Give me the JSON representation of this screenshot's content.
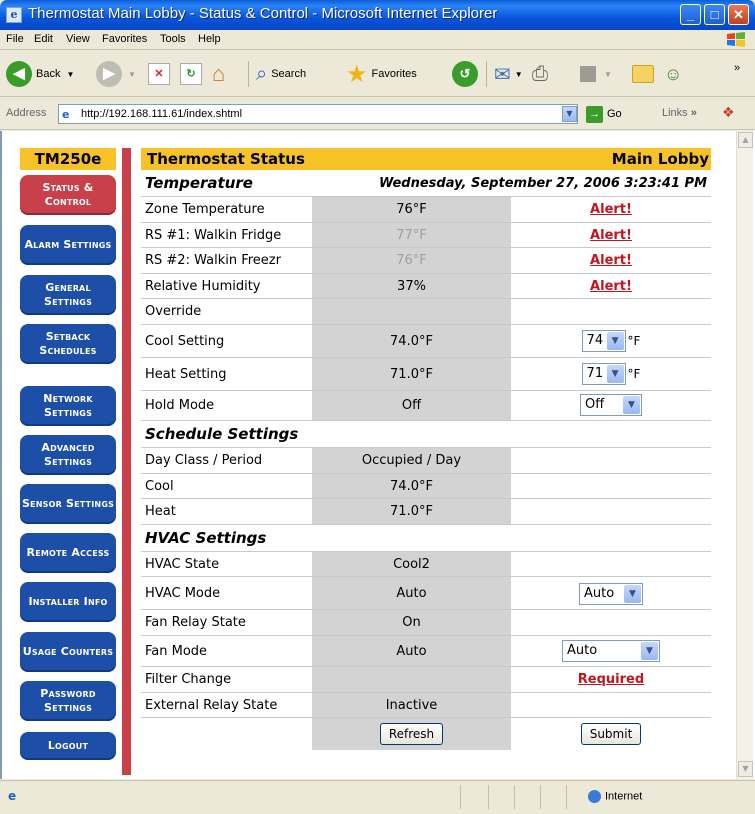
{
  "window": {
    "title": "Thermostat Main Lobby - Status & Control - Microsoft Internet Explorer"
  },
  "menu": [
    "File",
    "Edit",
    "View",
    "Favorites",
    "Tools",
    "Help"
  ],
  "toolbar": {
    "back": "Back",
    "search": "Search",
    "favorites": "Favorites"
  },
  "address": {
    "label": "Address",
    "url": "http://192.168.111.61/index.shtml",
    "go": "Go",
    "links": "Links"
  },
  "sidebar": {
    "brand": "TM250e",
    "items": [
      {
        "label": "Status & Control",
        "active": true
      },
      {
        "label": "Alarm Settings"
      },
      {
        "label": "General Settings"
      },
      {
        "label": "Setback Schedules"
      },
      {
        "label": "Network Settings"
      },
      {
        "label": "Advanced Settings"
      },
      {
        "label": "Sensor Settings"
      },
      {
        "label": "Remote Access"
      },
      {
        "label": "Installer Info"
      },
      {
        "label": "Usage Counters"
      },
      {
        "label": "Password Settings"
      },
      {
        "label": "Logout"
      }
    ]
  },
  "panel": {
    "title": "Thermostat Status",
    "location": "Main Lobby",
    "temperature": {
      "heading": "Temperature",
      "datetime": "Wednesday, September 27, 2006 3:23:41 PM",
      "rows": [
        {
          "label": "Zone Temperature",
          "value": "76°F",
          "status": "Alert!"
        },
        {
          "label": "RS #1: Walkin Fridge",
          "value": "77°F",
          "status": "Alert!"
        },
        {
          "label": "RS #2: Walkin Freezr",
          "value": "76°F",
          "status": "Alert!"
        },
        {
          "label": "Relative Humidity",
          "value": "37%",
          "status": "Alert!"
        }
      ],
      "override": "Override",
      "cool": {
        "label": "Cool Setting",
        "value": "74.0°F",
        "select": "74",
        "unit": "°F"
      },
      "heat": {
        "label": "Heat Setting",
        "value": "71.0°F",
        "select": "71",
        "unit": "°F"
      },
      "hold": {
        "label": "Hold Mode",
        "value": "Off",
        "select": "Off"
      }
    },
    "schedule": {
      "heading": "Schedule Settings",
      "rows": [
        {
          "label": "Day Class / Period",
          "value": "Occupied / Day"
        },
        {
          "label": "Cool",
          "value": "74.0°F"
        },
        {
          "label": "Heat",
          "value": "71.0°F"
        }
      ]
    },
    "hvac": {
      "heading": "HVAC Settings",
      "state": {
        "label": "HVAC State",
        "value": "Cool2"
      },
      "mode": {
        "label": "HVAC Mode",
        "value": "Auto",
        "select": "Auto"
      },
      "fan_relay": {
        "label": "Fan Relay State",
        "value": "On"
      },
      "fan_mode": {
        "label": "Fan Mode",
        "value": "Auto",
        "select": "Auto"
      },
      "filter": {
        "label": "Filter Change",
        "status": "Required"
      },
      "ext_relay": {
        "label": "External Relay State",
        "value": "Inactive"
      }
    },
    "refresh": "Refresh",
    "submit": "Submit"
  },
  "status": {
    "zone": "Internet"
  },
  "colors": {
    "nav": "#1d4fa8",
    "nav_active": "#c8404a",
    "header": "#f7c228",
    "alert": "#c3141f"
  }
}
